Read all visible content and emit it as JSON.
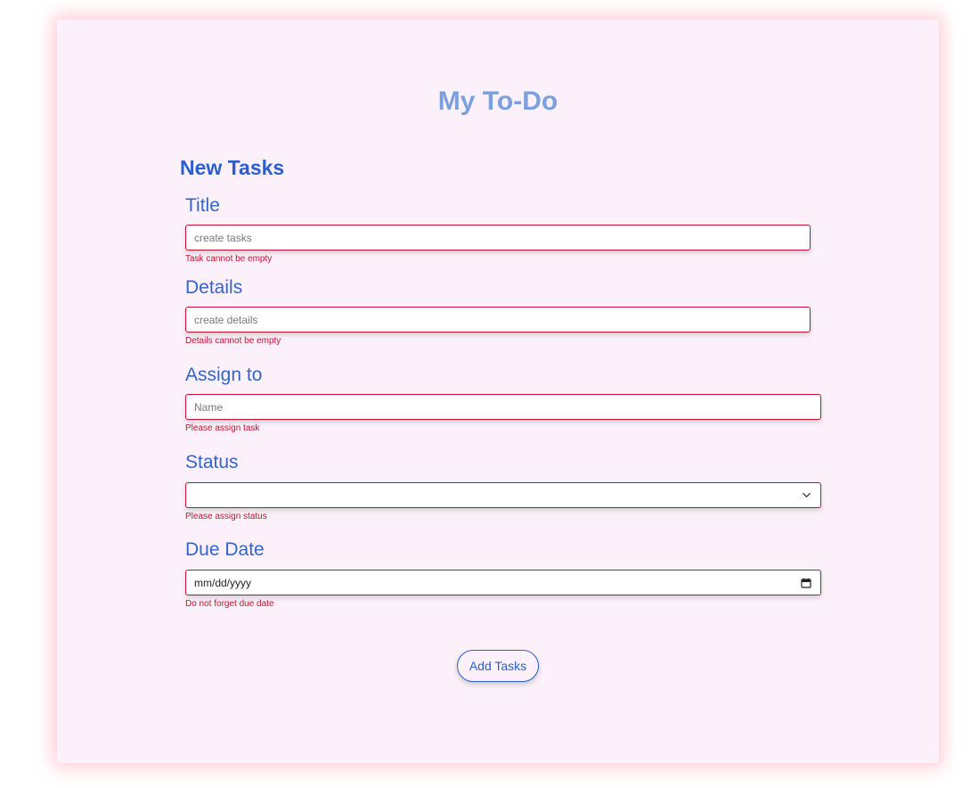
{
  "app": {
    "title": "My To-Do"
  },
  "form": {
    "section_title": "New Tasks",
    "title_field": {
      "label": "Title",
      "placeholder": "create tasks",
      "value": "",
      "error": "Task cannot be empty"
    },
    "details_field": {
      "label": "Details",
      "placeholder": "create details",
      "value": "",
      "error": "Details cannot be empty"
    },
    "assign_field": {
      "label": "Assign to",
      "placeholder": "Name",
      "value": "",
      "error": "Please assign task"
    },
    "status_field": {
      "label": "Status",
      "selected": "",
      "error": "Please assign status"
    },
    "due_date_field": {
      "label": "Due Date",
      "placeholder": "mm/dd/yyyy",
      "error": "Do not forget due date"
    },
    "submit_label": "Add Tasks"
  },
  "colors": {
    "card_background": "#fcf1fa",
    "title_color": "#7aa0e0",
    "accent": "#2a5fcf",
    "error": "#c8112e",
    "glow": "#ffaabe"
  },
  "icons": {
    "status_dropdown": "chevron-down-icon",
    "due_date_picker": "calendar-icon"
  }
}
